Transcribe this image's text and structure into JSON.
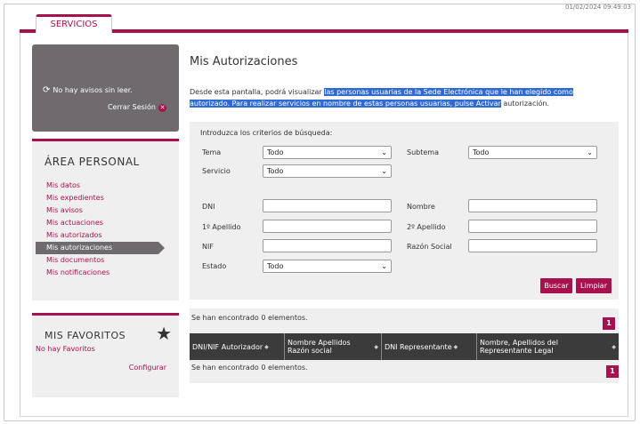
{
  "header": {
    "datetime": "01/02/2024 09:49:03",
    "tab_label": "SERVICIOS"
  },
  "notice": {
    "text": "No hay avisos sin leer.",
    "logout_label": "Cerrar Sesión"
  },
  "area": {
    "title": "ÁREA PERSONAL",
    "items": [
      "Mis datos",
      "Mis expedientes",
      "Mis avisos",
      "Mis actuaciones",
      "Mis autorizados",
      "Mis autorizaciones",
      "Mis documentos",
      "Mis notificaciones"
    ],
    "active_index": 5
  },
  "favorites": {
    "title": "MIS FAVORITOS",
    "empty_text": "No hay Favoritos",
    "config_label": "Configurar"
  },
  "main": {
    "title": "Mis Autorizaciones",
    "intro_plain_1": "Desde esta pantalla, podrá visualizar ",
    "intro_highlight": "las personas usuarias de la Sede Electrónica que le han elegido como autorizado. Para realizar servicios en nombre de estas personas usuarias, pulse Activar",
    "intro_plain_2": " autorización."
  },
  "search": {
    "heading": "Introduzca los criterios de búsqueda:",
    "tema_label": "Tema",
    "tema_value": "Todo",
    "subtema_label": "Subtema",
    "subtema_value": "Todo",
    "servicio_label": "Servicio",
    "servicio_value": "Todo",
    "dni_label": "DNI",
    "nombre_label": "Nombre",
    "apellido1_label": "1º Apellido",
    "apellido2_label": "2º Apellido",
    "nif_label": "NIF",
    "razon_label": "Razón Social",
    "estado_label": "Estado",
    "estado_value": "Todo",
    "search_button": "Buscar",
    "clear_button": "Limpiar"
  },
  "results": {
    "count_text": "Se han encontrado 0 elementos.",
    "page": "1",
    "columns": [
      "DNI/NIF Autorizador",
      "Nombre Apellidos Razón social",
      "DNI Representante",
      "Nombre, Apellidos del Representante Legal"
    ]
  },
  "colors": {
    "brand": "#a7124e",
    "panel_gray": "#6e6a6d",
    "highlight": "#2f6bd3"
  }
}
